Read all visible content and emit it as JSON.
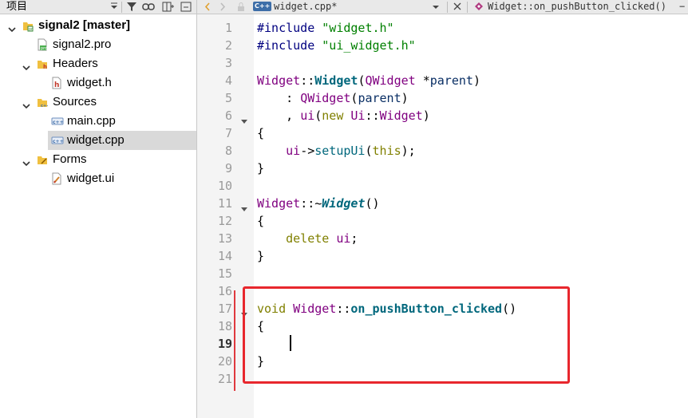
{
  "sidebar": {
    "title": "项目",
    "tree": [
      {
        "label": "signal2 [master]",
        "bold": true,
        "depth": 0,
        "arrow": "down",
        "icon": "project-folder-icon",
        "selected": false
      },
      {
        "label": "signal2.pro",
        "depth": 1,
        "arrow": null,
        "icon": "pro-file-icon",
        "selected": false
      },
      {
        "label": "Headers",
        "depth": 1,
        "arrow": "down",
        "icon": "headers-folder-icon",
        "selected": false
      },
      {
        "label": "widget.h",
        "depth": 2,
        "arrow": null,
        "icon": "header-file-icon",
        "selected": false
      },
      {
        "label": "Sources",
        "depth": 1,
        "arrow": "down",
        "icon": "sources-folder-icon",
        "selected": false
      },
      {
        "label": "main.cpp",
        "depth": 2,
        "arrow": null,
        "icon": "cpp-file-icon",
        "selected": false
      },
      {
        "label": "widget.cpp",
        "depth": 2,
        "arrow": null,
        "icon": "cpp-file-icon",
        "selected": true
      },
      {
        "label": "Forms",
        "depth": 1,
        "arrow": "down",
        "icon": "forms-folder-icon",
        "selected": false
      },
      {
        "label": "widget.ui",
        "depth": 2,
        "arrow": null,
        "icon": "ui-file-icon",
        "selected": false
      }
    ]
  },
  "editor": {
    "tab": {
      "badge": "C++",
      "filename": "widget.cpp*"
    },
    "symbol": "Widget::on_pushButton_clicked()",
    "symbol_suffix": "−",
    "current_line": 19,
    "line_numbers": [
      "1",
      "2",
      "3",
      "4",
      "5",
      "6",
      "7",
      "8",
      "9",
      "10",
      "11",
      "12",
      "13",
      "14",
      "15",
      "16",
      "17",
      "18",
      "19",
      "20",
      "21"
    ],
    "fold_lines": [
      6,
      11,
      17
    ],
    "lines": [
      [
        {
          "t": "#include ",
          "c": "pp"
        },
        {
          "t": "\"widget.h\"",
          "c": "str"
        }
      ],
      [
        {
          "t": "#include ",
          "c": "pp"
        },
        {
          "t": "\"ui_widget.h\"",
          "c": "str"
        }
      ],
      [],
      [
        {
          "t": "Widget",
          "c": "cls"
        },
        {
          "t": "::",
          "c": "op"
        },
        {
          "t": "Widget",
          "c": "fnb"
        },
        {
          "t": "(",
          "c": "op"
        },
        {
          "t": "QWidget",
          "c": "cls"
        },
        {
          "t": " *",
          "c": "op"
        },
        {
          "t": "parent",
          "c": "par"
        },
        {
          "t": ")",
          "c": "op"
        }
      ],
      [
        {
          "t": "    : ",
          "c": "op"
        },
        {
          "t": "QWidget",
          "c": "cls"
        },
        {
          "t": "(",
          "c": "op"
        },
        {
          "t": "parent",
          "c": "par"
        },
        {
          "t": ")",
          "c": "op"
        }
      ],
      [
        {
          "t": "    , ",
          "c": "op"
        },
        {
          "t": "ui",
          "c": "cls"
        },
        {
          "t": "(",
          "c": "op"
        },
        {
          "t": "new",
          "c": "kw"
        },
        {
          "t": " ",
          "c": "op"
        },
        {
          "t": "Ui",
          "c": "cls"
        },
        {
          "t": "::",
          "c": "op"
        },
        {
          "t": "Widget",
          "c": "cls"
        },
        {
          "t": ")",
          "c": "op"
        }
      ],
      [
        {
          "t": "{",
          "c": "op"
        }
      ],
      [
        {
          "t": "    ",
          "c": "op"
        },
        {
          "t": "ui",
          "c": "cls"
        },
        {
          "t": "->",
          "c": "op"
        },
        {
          "t": "setupUi",
          "c": "fn"
        },
        {
          "t": "(",
          "c": "op"
        },
        {
          "t": "this",
          "c": "kw"
        },
        {
          "t": ");",
          "c": "op"
        }
      ],
      [
        {
          "t": "}",
          "c": "op"
        }
      ],
      [],
      [
        {
          "t": "Widget",
          "c": "cls"
        },
        {
          "t": "::~",
          "c": "op"
        },
        {
          "t": "Widget",
          "c": "fnbi"
        },
        {
          "t": "()",
          "c": "op"
        }
      ],
      [
        {
          "t": "{",
          "c": "op"
        }
      ],
      [
        {
          "t": "    ",
          "c": "op"
        },
        {
          "t": "delete",
          "c": "kw"
        },
        {
          "t": " ",
          "c": "op"
        },
        {
          "t": "ui",
          "c": "cls"
        },
        {
          "t": ";",
          "c": "op"
        }
      ],
      [
        {
          "t": "}",
          "c": "op"
        }
      ],
      [],
      [],
      [
        {
          "t": "void",
          "c": "kw"
        },
        {
          "t": " ",
          "c": "op"
        },
        {
          "t": "Widget",
          "c": "cls"
        },
        {
          "t": "::",
          "c": "op"
        },
        {
          "t": "on_pushButton_clicked",
          "c": "fnb"
        },
        {
          "t": "()",
          "c": "op"
        }
      ],
      [
        {
          "t": "{",
          "c": "op"
        }
      ],
      [],
      [
        {
          "t": "}",
          "c": "op"
        }
      ],
      []
    ]
  },
  "colors": {
    "change_marker": "#e0393e",
    "highlight_box": "#e8272d",
    "selected_row": "#d9d9d9"
  }
}
